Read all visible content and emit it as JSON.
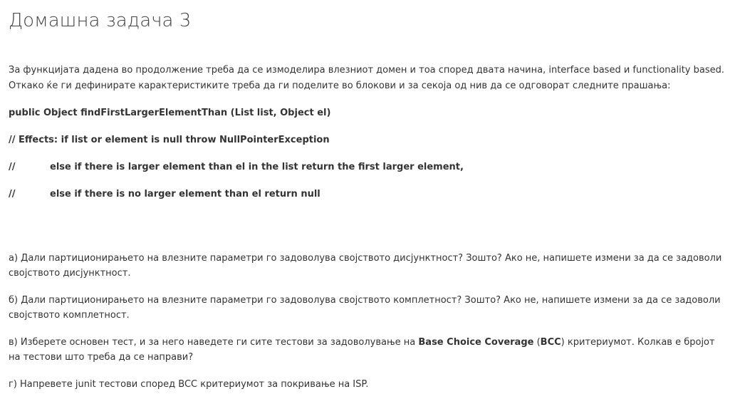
{
  "title": "Домашна задача 3",
  "intro": {
    "line1": "За функцијата дадена во продолжение треба да се измоделира влезниот домен и тоа според двата начина, interface based и functionality based.",
    "line2": "Откако ќе ги дефинирате карактеристиките треба да ги поделите во блокови и за секоја од нив да се одговорат следните прашања:"
  },
  "code": {
    "signature": "public Object findFirstLargerElementThan  (List list, Object el)",
    "effects": "// Effects: if list or element is null throw NullPointerException",
    "line2_prefix": "//",
    "line2_text": "else if there is larger element than el in the list return the first larger element,",
    "line3_prefix": "//",
    "line3_text": "else if there is no larger element than el return null"
  },
  "questions": {
    "a": "а) Дали партиционирањето на влезните параметри го задоволува својството дисјунктност? Зошто? Ако не, напишете измени за да се задоволи својството дисјунктност.",
    "b": "б) Дали партиционирањето на влезните параметри го задоволува својството комплетност? Зошто? Ако не, напишете измени за да се задоволи својството комплетност.",
    "c_part1": "в) Изберете основен тест, и за него наведете ги сите тестови за задоволување на ",
    "c_bold1": "Base Choice Coverage",
    "c_part2": " (",
    "c_bold2": "BCC",
    "c_part3": ") критериумот. Колкав е бројот на тестови што треба да се направи?",
    "d": "г) Напревете junit тестови според BCC критериумот за покривање на ISP."
  }
}
